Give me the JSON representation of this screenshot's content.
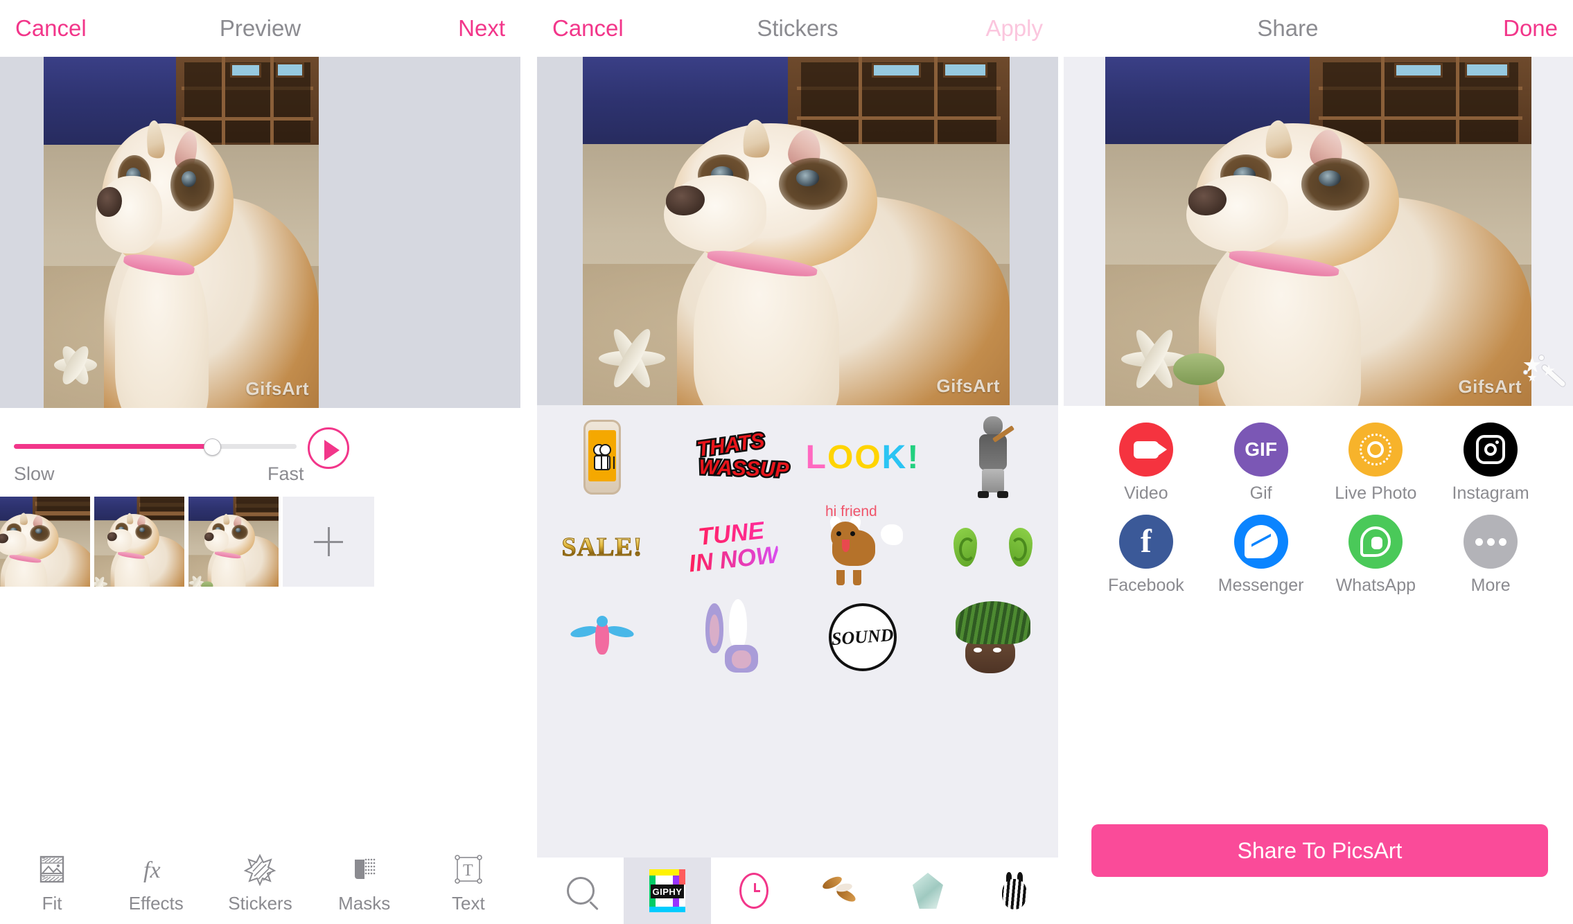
{
  "app": "GifsArt",
  "colors": {
    "accent_pink": "#f2368a",
    "accent_pink_button": "#fa4b99",
    "accent_disabled": "#fbc6de",
    "label_gray": "#8b8b90",
    "stage_bg": "#d6d8e0",
    "panel_bg": "#eeeef3"
  },
  "panels": {
    "preview": {
      "nav": {
        "cancel_label": "Cancel",
        "title": "Preview",
        "next_label": "Next"
      },
      "watermark": "GifsArt",
      "speed": {
        "slow_label": "Slow",
        "fast_label": "Fast",
        "value_percent": 70,
        "play_label": "Play"
      },
      "frames": [
        {
          "name": "frame-1"
        },
        {
          "name": "frame-2"
        },
        {
          "name": "frame-3"
        }
      ],
      "add_frame_label": "+",
      "tools": [
        {
          "label": "Fit",
          "icon": "fit-icon"
        },
        {
          "label": "Effects",
          "icon": "effects-icon"
        },
        {
          "label": "Stickers",
          "icon": "stickers-icon"
        },
        {
          "label": "Masks",
          "icon": "masks-icon"
        },
        {
          "label": "Text",
          "icon": "text-icon"
        }
      ]
    },
    "stickers": {
      "nav": {
        "cancel_label": "Cancel",
        "title": "Stickers",
        "apply_label": "Apply",
        "apply_disabled": true
      },
      "watermark": "GifsArt",
      "items": [
        {
          "name": "smiley-phone-sticker",
          "text": ""
        },
        {
          "name": "thats-wassup-sticker",
          "text": "THATS WASSUP",
          "line1": "THATS",
          "line2": "WASSUP"
        },
        {
          "name": "look-sticker",
          "text": "LOOK!"
        },
        {
          "name": "guitar-player-sticker",
          "text": ""
        },
        {
          "name": "sale-sticker",
          "text": "SALE!"
        },
        {
          "name": "tune-in-now-sticker",
          "text": "TUNE IN NOW",
          "line1": "TUNE",
          "line2": "IN NOW"
        },
        {
          "name": "hi-friend-dog-sticker",
          "text": "hi friend"
        },
        {
          "name": "green-ears-sticker",
          "text": ""
        },
        {
          "name": "blue-bird-sticker",
          "text": ""
        },
        {
          "name": "bunny-ears-sticker",
          "text": ""
        },
        {
          "name": "sound-circle-sticker",
          "text": "SOUND"
        },
        {
          "name": "green-hair-sticker",
          "text": ""
        }
      ],
      "tabs": [
        {
          "name": "search-tab",
          "icon": "search-icon",
          "label": "",
          "active": false
        },
        {
          "name": "giphy-tab",
          "icon": "giphy-icon",
          "label": "GIPHY",
          "active": true
        },
        {
          "name": "recent-tab",
          "icon": "clock-icon",
          "label": "",
          "active": false
        },
        {
          "name": "hawk-tab",
          "icon": "hawk-icon",
          "label": "",
          "active": false
        },
        {
          "name": "crystal-tab",
          "icon": "crystal-icon",
          "label": "",
          "active": false
        },
        {
          "name": "zebra-tab",
          "icon": "zebra-icon",
          "label": "",
          "active": false
        }
      ]
    },
    "share": {
      "nav": {
        "title": "Share",
        "done_label": "Done"
      },
      "watermark": "GifsArt",
      "magic_wand_icon": "magic-wand-icon",
      "targets": [
        {
          "label": "Video",
          "icon": "video-icon",
          "color": "#f5333f"
        },
        {
          "label": "Gif",
          "icon": "gif-icon",
          "color": "#7b57b5",
          "text": "GIF"
        },
        {
          "label": "Live Photo",
          "icon": "live-photo-icon",
          "color": "#f7b32b"
        },
        {
          "label": "Instagram",
          "icon": "instagram-icon",
          "color": "#000000"
        },
        {
          "label": "Facebook",
          "icon": "facebook-icon",
          "color": "#3b5998",
          "text": "f"
        },
        {
          "label": "Messenger",
          "icon": "messenger-icon",
          "color": "#0a84ff"
        },
        {
          "label": "WhatsApp",
          "icon": "whatsapp-icon",
          "color": "#4ac959"
        },
        {
          "label": "More",
          "icon": "more-icon",
          "color": "#b3b3b8"
        }
      ],
      "share_button_label": "Share To PicsArt"
    }
  }
}
